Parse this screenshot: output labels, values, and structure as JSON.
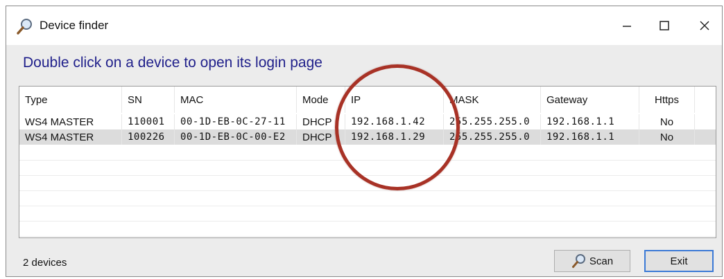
{
  "window": {
    "title": "Device finder",
    "title_icon": "magnifier-icon",
    "controls": {
      "minimize": "—",
      "maximize": "☐",
      "close": "✕"
    }
  },
  "instruction": "Double click on a device to open its login page",
  "table": {
    "columns": [
      "Type",
      "SN",
      "MAC",
      "Mode",
      "IP",
      "MASK",
      "Gateway",
      "Https"
    ],
    "rows": [
      [
        "WS4 MASTER",
        "110001",
        "00-1D-EB-0C-27-11",
        "DHCP",
        "192.168.1.42",
        "255.255.255.0",
        "192.168.1.1",
        "No"
      ],
      [
        "WS4 MASTER",
        "100226",
        "00-1D-EB-0C-00-E2",
        "DHCP",
        "192.168.1.29",
        "255.255.255.0",
        "192.168.1.1",
        "No"
      ]
    ],
    "selected_row_index": 1
  },
  "status": "2 devices",
  "buttons": {
    "scan": "Scan",
    "exit": "Exit"
  },
  "colors": {
    "instruction": "#1f1f8a",
    "highlight_circle": "#a83226",
    "selected_row": "#dcdcdc"
  }
}
